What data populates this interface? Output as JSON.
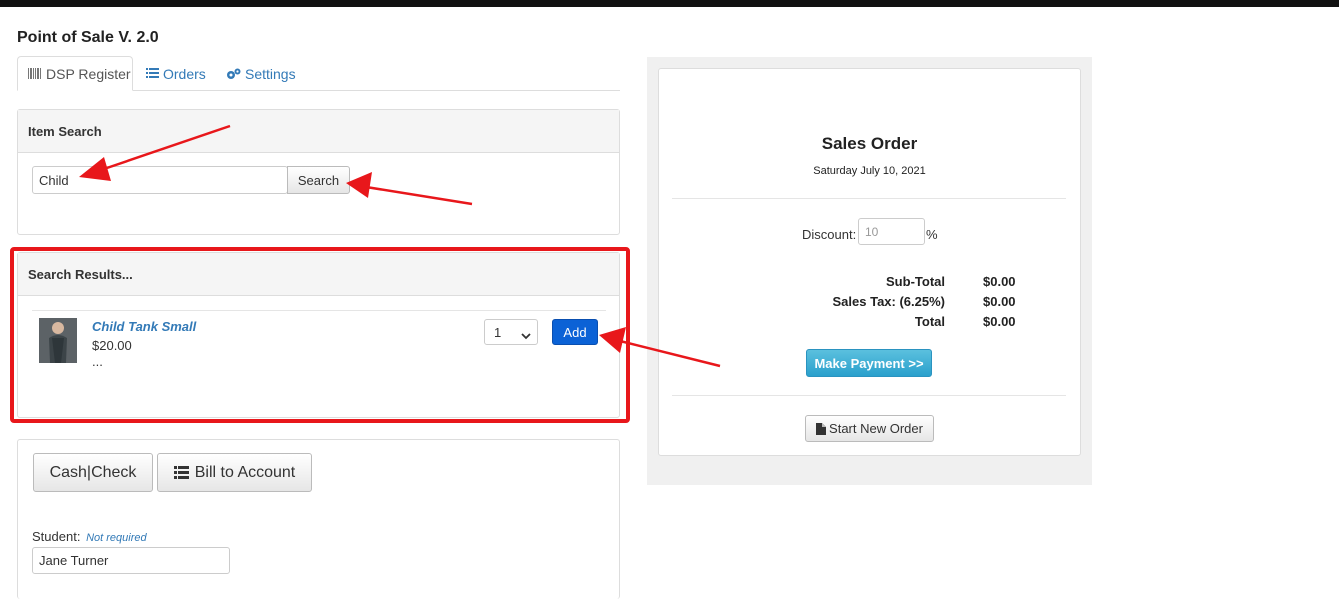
{
  "app": {
    "title": "Point of Sale V. 2.0"
  },
  "tabs": [
    {
      "label": "DSP Register",
      "icon": "barcode-icon",
      "active": true
    },
    {
      "label": "Orders",
      "icon": "list-icon",
      "active": false
    },
    {
      "label": "Settings",
      "icon": "gears-icon",
      "active": false
    }
  ],
  "item_search": {
    "heading": "Item Search",
    "query": "Child",
    "search_label": "Search"
  },
  "results": {
    "heading": "Search Results...",
    "items": [
      {
        "name": "Child Tank Small",
        "price": "$20.00",
        "extra": "...",
        "quantity": "1",
        "add_label": "Add",
        "thumbnail": "product-photo"
      }
    ]
  },
  "payment": {
    "cash_label": "Cash|Check",
    "bill_label": "Bill to Account",
    "student_label": "Student:",
    "student_hint": "Not required",
    "student_value": "Jane Turner"
  },
  "order": {
    "title": "Sales Order",
    "date": "Saturday July 10, 2021",
    "discount_label": "Discount:",
    "discount_placeholder": "10",
    "discount_unit": "%",
    "subtotal_label": "Sub-Total",
    "subtotal": "$0.00",
    "tax_label": "Sales Tax: (6.25%)",
    "tax": "$0.00",
    "total_label": "Total",
    "total": "$0.00",
    "make_payment_label": "Make Payment >>",
    "new_order_label": "Start New Order"
  },
  "colors": {
    "accent_link": "#337ab7",
    "primary_button": "#0b62d6",
    "info_button": "#3aaed8",
    "annotation_red": "#e8171b"
  }
}
